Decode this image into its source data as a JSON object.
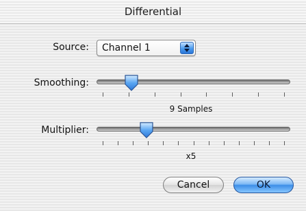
{
  "window": {
    "title": "Differential"
  },
  "source": {
    "label": "Source:",
    "selected": "Channel 1"
  },
  "smoothing": {
    "label": "Smoothing:",
    "value_text": "9 Samples",
    "position": 0.16,
    "tick_count": 8
  },
  "multiplier": {
    "label": "Multiplier:",
    "value_text": "x5",
    "position": 0.24,
    "tick_count": 13
  },
  "buttons": {
    "cancel": "Cancel",
    "ok": "OK"
  },
  "colors": {
    "accent": "#3d8ee8"
  }
}
